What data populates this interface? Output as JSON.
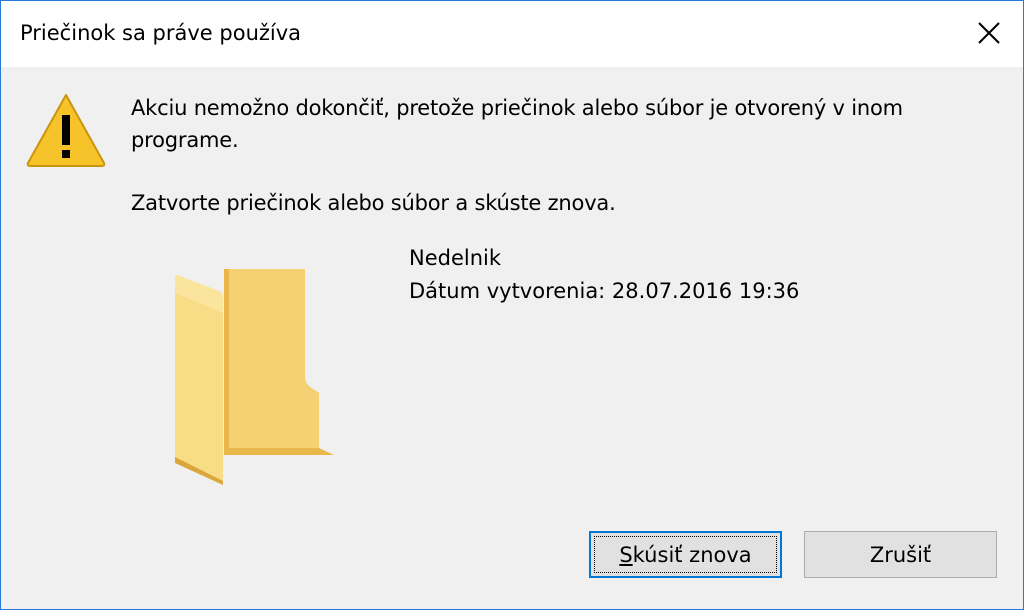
{
  "dialog": {
    "title": "Priečinok sa práve používa",
    "message_line1": "Akciu nemožno dokončiť, pretože priečinok alebo súbor je otvorený v inom programe.",
    "message_line2": "Zatvorte priečinok alebo súbor a skúste znova.",
    "item": {
      "name": "Nedelnik",
      "created": "Dátum vytvorenia: 28.07.2016 19:36"
    },
    "buttons": {
      "retry_first_char": "S",
      "retry_rest": "kúsiť znova",
      "cancel_label": "Zrušiť"
    }
  },
  "icons": {
    "warning": "warning-triangle-icon",
    "folder": "folder-icon",
    "close": "close-icon"
  },
  "colors": {
    "warning_fill": "#f7c32b",
    "folder_fill": "#f8d775",
    "accent": "#0078d7"
  }
}
